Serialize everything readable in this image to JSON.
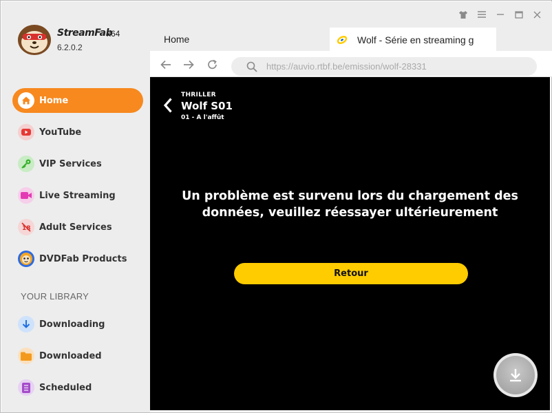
{
  "app": {
    "name": "StreamFab",
    "arch": "x64",
    "version": "6.2.0.2"
  },
  "sidebar": {
    "items": [
      {
        "label": "Home",
        "icon": "home-icon",
        "active": true
      },
      {
        "label": "YouTube",
        "icon": "youtube-icon"
      },
      {
        "label": "VIP Services",
        "icon": "key-icon"
      },
      {
        "label": "Live Streaming",
        "icon": "camera-icon"
      },
      {
        "label": "Adult Services",
        "icon": "adult-blocked-icon"
      },
      {
        "label": "DVDFab Products",
        "icon": "dvdfab-icon"
      }
    ],
    "library_title": "YOUR LIBRARY",
    "library": [
      {
        "label": "Downloading",
        "icon": "download-arrow-icon"
      },
      {
        "label": "Downloaded",
        "icon": "folder-icon"
      },
      {
        "label": "Scheduled",
        "icon": "schedule-list-icon"
      }
    ]
  },
  "tabs": {
    "home_label": "Home",
    "active_title": "Wolf - Série en streaming g"
  },
  "address": {
    "url": "https://auvio.rtbf.be/emission/wolf-28331"
  },
  "page": {
    "genre": "THRILLER",
    "title": "Wolf S01",
    "episode": "01 - A l'affût",
    "error": "Un problème est survenu lors du chargement des données, veuillez réessayer ultérieurement",
    "button": "Retour"
  },
  "colors": {
    "accent": "#f7891f",
    "button_yellow": "#ffcc00",
    "sidebar_bg": "#ededed",
    "content_bg": "#000000"
  }
}
